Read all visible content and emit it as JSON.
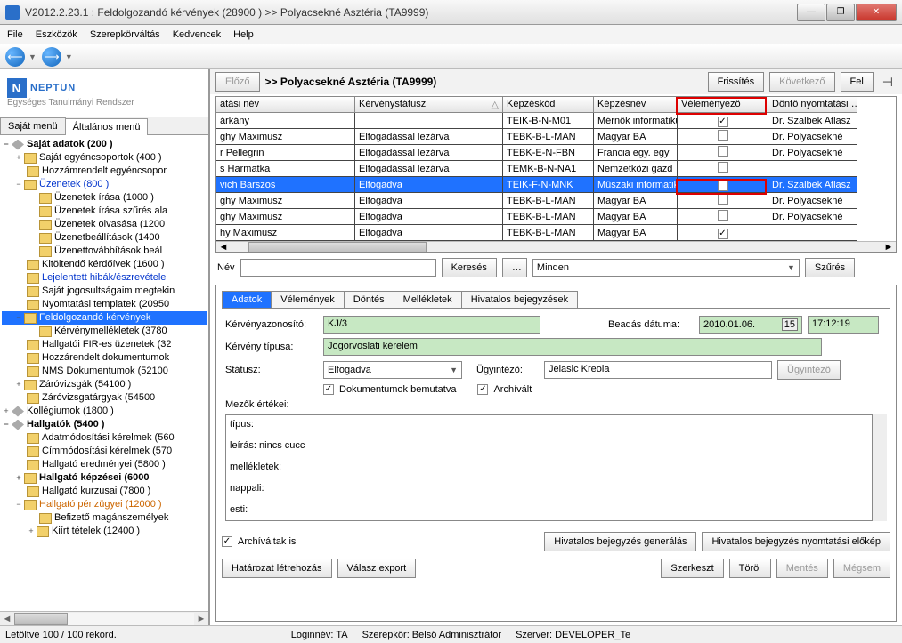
{
  "window": {
    "title": "V2012.2.23.1 : Feldolgozandó kérvények (28900  )  >> Polyacsekné Asztéria (TA9999)"
  },
  "menu": {
    "file": "File",
    "eszkozok": "Eszközök",
    "szerepkor": "Szerepkörváltás",
    "kedvencek": "Kedvencek",
    "help": "Help"
  },
  "logo": {
    "name": "NEPTUN",
    "tagline": "Egységes Tanulmányi Rendszer"
  },
  "sbtabs": {
    "sajat": "Saját menü",
    "alt": "Általános menü"
  },
  "tree": {
    "n_sajat": "Saját adatok (200  )",
    "n_egyen": "Saját egyéncsoportok (400  )",
    "n_hozza_e": "Hozzámrendelt egyéncsopor",
    "n_uzenetek": "Üzenetek (800  )",
    "n_uz_irasa": "Üzenetek írása (1000  )",
    "n_uz_irasa_sz": "Üzenetek írása szűrés ala",
    "n_uz_olv": "Üzenetek olvasása (1200",
    "n_uz_beall": "Üzenetbeállítások (1400",
    "n_uz_tov": "Üzenettovábbítások beál",
    "n_kit": "Kitöltendő kérdőívek (1600  )",
    "n_lejel": "Lejelentett hibák/észrevétele",
    "n_sajjog": "Saját jogosultságaim megtekin",
    "n_nyomt": "Nyomtatási templatek (20950",
    "n_feld": "Feldolgozandó kérvények",
    "n_kervm": "Kérvénymellékletek (3780",
    "n_hallf": "Hallgatói FIR-es üzenetek (32",
    "n_hozza_d": "Hozzárendelt dokumentumok",
    "n_nms": "NMS Dokumentumok (52100",
    "n_zarov": "Záróvizsgák (54100  )",
    "n_zarotargy": "Záróvizsgatárgyak (54500",
    "n_kolleg": "Kollégiumok (1800  )",
    "n_hallg": "Hallgatók (5400  )",
    "n_adat": "Adatmódosítási kérelmek (560",
    "n_cim": "Címmódosítási kérelmek (570",
    "n_hallered": "Hallgató eredményei (5800  )",
    "n_hallkep": "Hallgató képzései (6000",
    "n_hallkurz": "Hallgató kurzusai (7800  )",
    "n_hallpenz": "Hallgató pénzügyei (12000  )",
    "n_befiz": "Befizető magánszemélyek",
    "n_kiirt": "Kiírt tételek (12400  )"
  },
  "top": {
    "prev": "Előző",
    "heading": ">>  Polyacsekné Asztéria (TA9999)",
    "refresh": "Frissítés",
    "next": "Következő",
    "up": "Fel"
  },
  "grid": {
    "headers": {
      "c1": "atási név",
      "c2": "Kérvénystátusz",
      "c3": "Képzéskód",
      "c4": "Képzésnév",
      "c5": "Véleményező",
      "c6": "Döntő nyomtatási …"
    },
    "rows": [
      {
        "c1": "árkány",
        "c2": "",
        "c3": "TEIK-B-N-M01",
        "c4": "Mérnök informatikus",
        "c5": true,
        "c6": "Dr. Szalbek Atlasz"
      },
      {
        "c1": "ghy Maximusz",
        "c2": "Elfogadással lezárva",
        "c3": "TEBK-B-L-MAN",
        "c4": "Magyar BA",
        "c5": false,
        "c6": "Dr. Polyacsekné"
      },
      {
        "c1": "r Pellegrin",
        "c2": "Elfogadással lezárva",
        "c3": "TEBK-E-N-FBN",
        "c4": "Francia egy. egy",
        "c5": false,
        "c6": "Dr. Polyacsekné"
      },
      {
        "c1": "s Harmatka",
        "c2": "Elfogadással lezárva",
        "c3": "TEMK-B-N-NA1",
        "c4": "Nemzetközi gazd",
        "c5": false,
        "c6": ""
      },
      {
        "c1": "vich Barszos",
        "c2": "Elfogadva",
        "c3": "TEIK-F-N-MNK",
        "c4": "Műszaki informatik",
        "c5": true,
        "c6": "Dr. Szalbek Atlasz"
      },
      {
        "c1": "ghy Maximusz",
        "c2": "Elfogadva",
        "c3": "TEBK-B-L-MAN",
        "c4": "Magyar BA",
        "c5": false,
        "c6": "Dr. Polyacsekné"
      },
      {
        "c1": "ghy Maximusz",
        "c2": "Elfogadva",
        "c3": "TEBK-B-L-MAN",
        "c4": "Magyar BA",
        "c5": false,
        "c6": "Dr. Polyacsekné"
      },
      {
        "c1": "hy Maximusz",
        "c2": "Elfogadva",
        "c3": "TEBK-B-L-MAN",
        "c4": "Magyar BA",
        "c5": true,
        "c6": ""
      }
    ]
  },
  "search": {
    "nev": "Név",
    "kereses": "Keresés",
    "dots": "…",
    "minden": "Minden",
    "szures": "Szűrés"
  },
  "dtabs": {
    "adatok": "Adatok",
    "velem": "Vélemények",
    "dontes": "Döntés",
    "mell": "Mellékletek",
    "hiv": "Hivatalos bejegyzések"
  },
  "detail": {
    "l_azon": "Kérvényazonosító:",
    "v_azon": "KJ/3",
    "l_bead": "Beadás dátuma:",
    "v_bead": "2010.01.06.",
    "v_time": "17:12:19",
    "l_tipus": "Kérvény típusa:",
    "v_tipus": "Jogorvoslati kérelem",
    "l_status": "Státusz:",
    "v_status": "Elfogadva",
    "l_ugy": "Ügyintéző:",
    "v_ugy": "Jelasic Kreola",
    "b_ugy": "Ügyintéző",
    "cb_dok": "Dokumentumok bemutatva",
    "cb_arch": "Archívált",
    "l_mezok": "Mezők értékei:",
    "ta_l1": "típus:",
    "ta_l2": "leírás: nincs cucc",
    "ta_l3": "mellékletek:",
    "ta_l4": "nappali:",
    "ta_l5": "esti:",
    "cb_archis": "Archíváltak is"
  },
  "bottom": {
    "b_hivgen": "Hivatalos bejegyzés generálás",
    "b_hivnyom": "Hivatalos bejegyzés nyomtatási előkép",
    "b_hatar": "Határozat létrehozás",
    "b_valasz": "Válasz export",
    "b_szerk": "Szerkeszt",
    "b_torol": "Töröl",
    "b_mentes": "Mentés",
    "b_megsem": "Mégsem"
  },
  "status": {
    "rec": "Letöltve 100 / 100 rekord.",
    "login": "Loginnév: TA",
    "role": "Szerepkör: Belső Adminisztrátor",
    "server": "Szerver: DEVELOPER_Te"
  }
}
